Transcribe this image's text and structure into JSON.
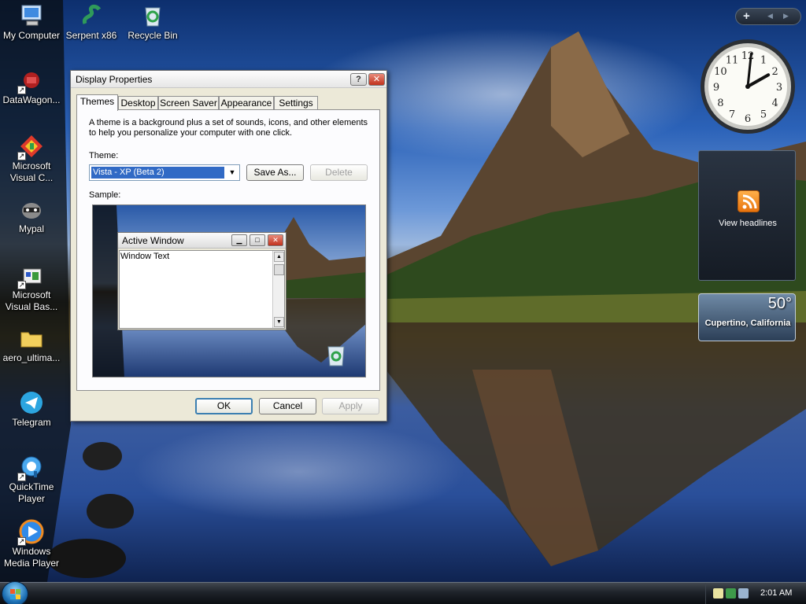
{
  "desktop": {
    "icons": [
      {
        "label": "My Computer"
      },
      {
        "label": "Serpent x86"
      },
      {
        "label": "Recycle Bin"
      },
      {
        "label": "DataWagon..."
      },
      {
        "label": "Microsoft Visual C..."
      },
      {
        "label": "Mypal"
      },
      {
        "label": "Microsoft Visual Bas..."
      },
      {
        "label": "aero_ultima..."
      },
      {
        "label": "Telegram"
      },
      {
        "label": "QuickTime Player"
      },
      {
        "label": "Windows Media Player"
      }
    ]
  },
  "dialog": {
    "title": "Display Properties",
    "help_glyph": "?",
    "close_glyph": "✕",
    "tabs": [
      {
        "label": "Themes",
        "active": true
      },
      {
        "label": "Desktop"
      },
      {
        "label": "Screen Saver"
      },
      {
        "label": "Appearance"
      },
      {
        "label": "Settings"
      }
    ],
    "description": "A theme is a background plus a set of sounds, icons, and other elements to help you personalize your computer with one click.",
    "theme_label": "Theme:",
    "theme_value": "Vista - XP (Beta 2)",
    "save_as_label": "Save As...",
    "delete_label": "Delete",
    "sample_label": "Sample:",
    "sample_window": {
      "title": "Active Window",
      "text": "Window Text"
    },
    "ok_label": "OK",
    "cancel_label": "Cancel",
    "apply_label": "Apply"
  },
  "sidebar": {
    "add_glyph": "+",
    "prev_glyph": "◀",
    "next_glyph": "▶",
    "clock": {
      "hour": 2,
      "minute": 1
    },
    "feed_label": "View headlines",
    "weather": {
      "temp": "50°",
      "city": "Cupertino, California"
    }
  },
  "taskbar": {
    "time": "2:01 AM"
  },
  "colors": {
    "selection": "#316ac5",
    "dialog_bg": "#ece9d8",
    "close_red": "#c0321d",
    "taskbar_dark": "#0b0e12"
  }
}
